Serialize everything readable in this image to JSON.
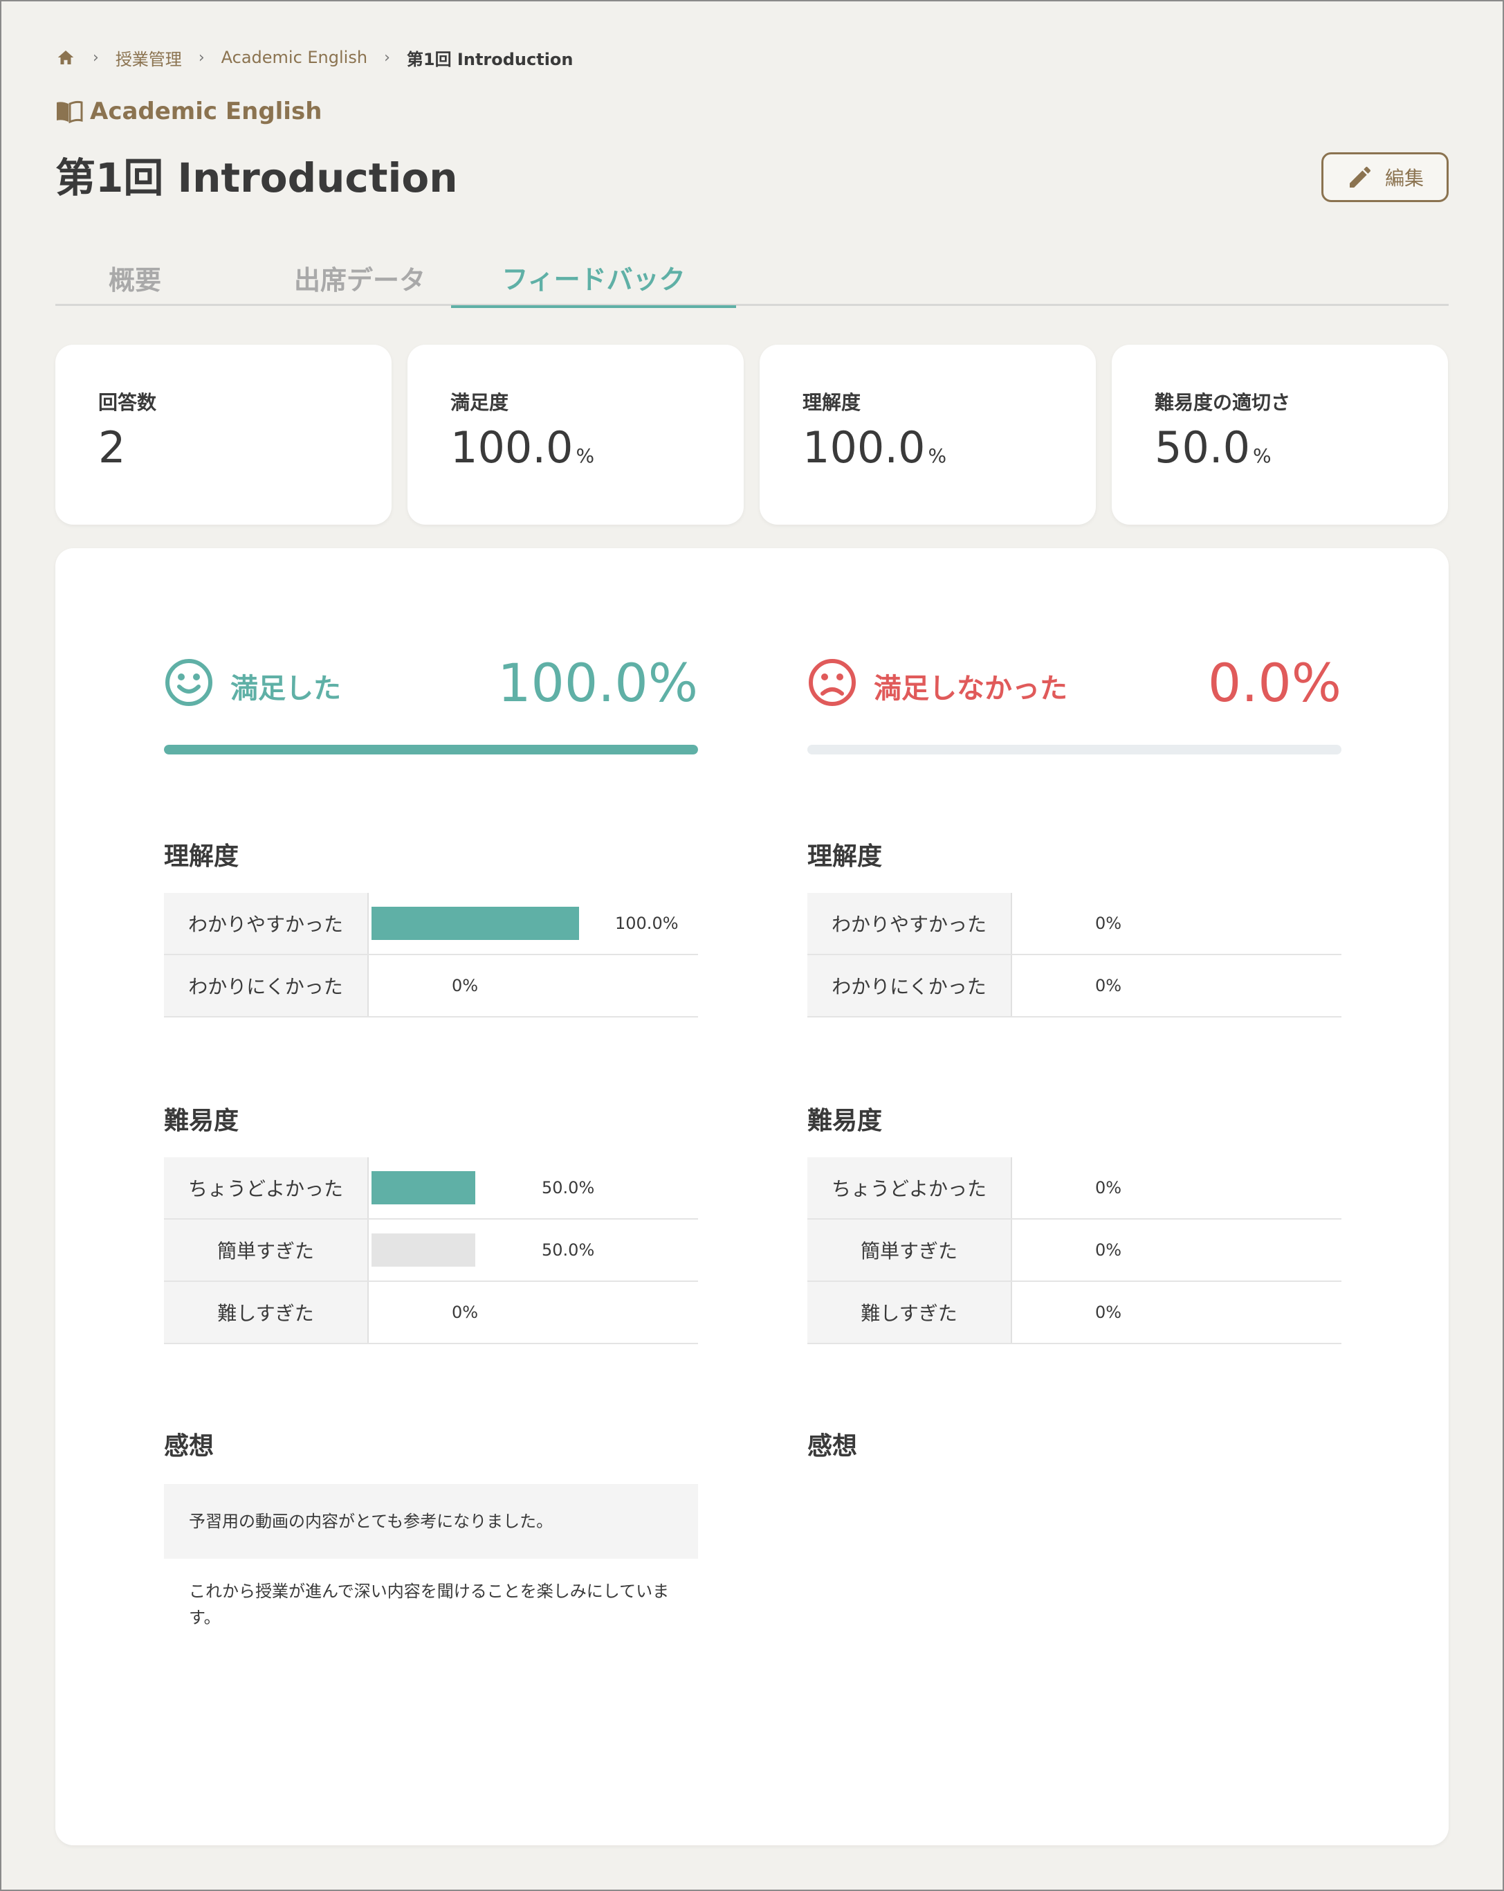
{
  "breadcrumb": {
    "items": [
      "授業管理",
      "Academic English"
    ],
    "current": "第1回 Introduction",
    "separator": "›"
  },
  "course_name": "Academic English",
  "page_title": "第1回 Introduction",
  "edit_label": "編集",
  "tabs": [
    {
      "label": "概要",
      "active": false
    },
    {
      "label": "出席データ",
      "active": false
    },
    {
      "label": "フィードバック",
      "active": true
    }
  ],
  "stats": [
    {
      "label": "回答数",
      "value": "2",
      "unit": ""
    },
    {
      "label": "満足度",
      "value": "100.0",
      "unit": "%"
    },
    {
      "label": "理解度",
      "value": "100.0",
      "unit": "%"
    },
    {
      "label": "難易度の適切さ",
      "value": "50.0",
      "unit": "%"
    }
  ],
  "colors": {
    "accent": "#5fb0a6",
    "negative": "#e05a5a",
    "brand": "#8b7350",
    "muted_bar": "#e4e4e4"
  },
  "columns": [
    {
      "label": "満足した",
      "value": "100.0%",
      "fraction": 1.0,
      "icon": "smile-icon",
      "tone": "positive",
      "understanding": {
        "title": "理解度",
        "rows": [
          {
            "label": "わかりやすかった",
            "pct": "100.0%",
            "fraction": 1.0,
            "style": "accent"
          },
          {
            "label": "わかりにくかった",
            "pct": "0%",
            "fraction": 0.0,
            "style": "none"
          }
        ]
      },
      "difficulty": {
        "title": "難易度",
        "rows": [
          {
            "label": "ちょうどよかった",
            "pct": "50.0%",
            "fraction": 0.5,
            "style": "accent"
          },
          {
            "label": "簡単すぎた",
            "pct": "50.0%",
            "fraction": 0.5,
            "style": "muted"
          },
          {
            "label": "難しすぎた",
            "pct": "0%",
            "fraction": 0.0,
            "style": "none"
          }
        ]
      },
      "comments_title": "感想",
      "comments": [
        "予習用の動画の内容がとても参考になりました。",
        "これから授業が進んで深い内容を聞けることを楽しみにしています。"
      ]
    },
    {
      "label": "満足しなかった",
      "value": "0.0%",
      "fraction": 0.0,
      "icon": "frown-icon",
      "tone": "negative",
      "understanding": {
        "title": "理解度",
        "rows": [
          {
            "label": "わかりやすかった",
            "pct": "0%",
            "fraction": 0.0,
            "style": "none"
          },
          {
            "label": "わかりにくかった",
            "pct": "0%",
            "fraction": 0.0,
            "style": "none"
          }
        ]
      },
      "difficulty": {
        "title": "難易度",
        "rows": [
          {
            "label": "ちょうどよかった",
            "pct": "0%",
            "fraction": 0.0,
            "style": "none"
          },
          {
            "label": "簡単すぎた",
            "pct": "0%",
            "fraction": 0.0,
            "style": "none"
          },
          {
            "label": "難しすぎた",
            "pct": "0%",
            "fraction": 0.0,
            "style": "none"
          }
        ]
      },
      "comments_title": "感想",
      "comments": []
    }
  ]
}
